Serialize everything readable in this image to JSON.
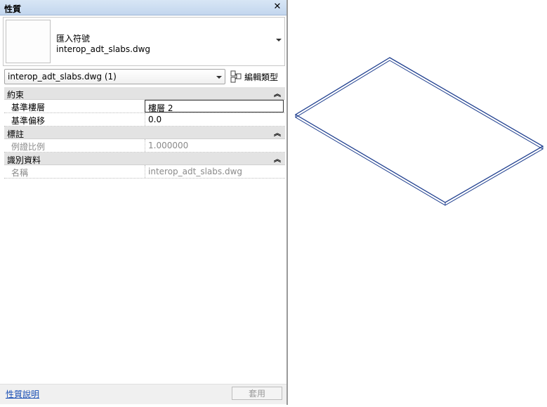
{
  "panel": {
    "title": "性質",
    "close_icon": "close-icon"
  },
  "type_selector": {
    "category": "匯入符號",
    "name": "interop_adt_slabs.dwg"
  },
  "instance_selector": {
    "value": "interop_adt_slabs.dwg (1)"
  },
  "edit_type": {
    "label": "編輯類型",
    "icon": "edit-type-icon"
  },
  "groups": [
    {
      "label": "約束",
      "collapse_glyph": "⌃",
      "rows": [
        {
          "label": "基準樓層",
          "value": "樓層 2"
        },
        {
          "label": "基準偏移",
          "value": "0.0"
        }
      ]
    },
    {
      "label": "標註",
      "collapse_glyph": "⌃",
      "rows": [
        {
          "label": "例證比例",
          "value": "1.000000"
        }
      ]
    },
    {
      "label": "識別資料",
      "collapse_glyph": "⌃",
      "rows": [
        {
          "label": "名稱",
          "value": "interop_adt_slabs.dwg"
        }
      ]
    }
  ],
  "footer": {
    "help_link": "性質說明",
    "apply_label": "套用"
  },
  "colors": {
    "slab_outline": "#1f3f8f",
    "title_bar": "#c9daf0"
  }
}
